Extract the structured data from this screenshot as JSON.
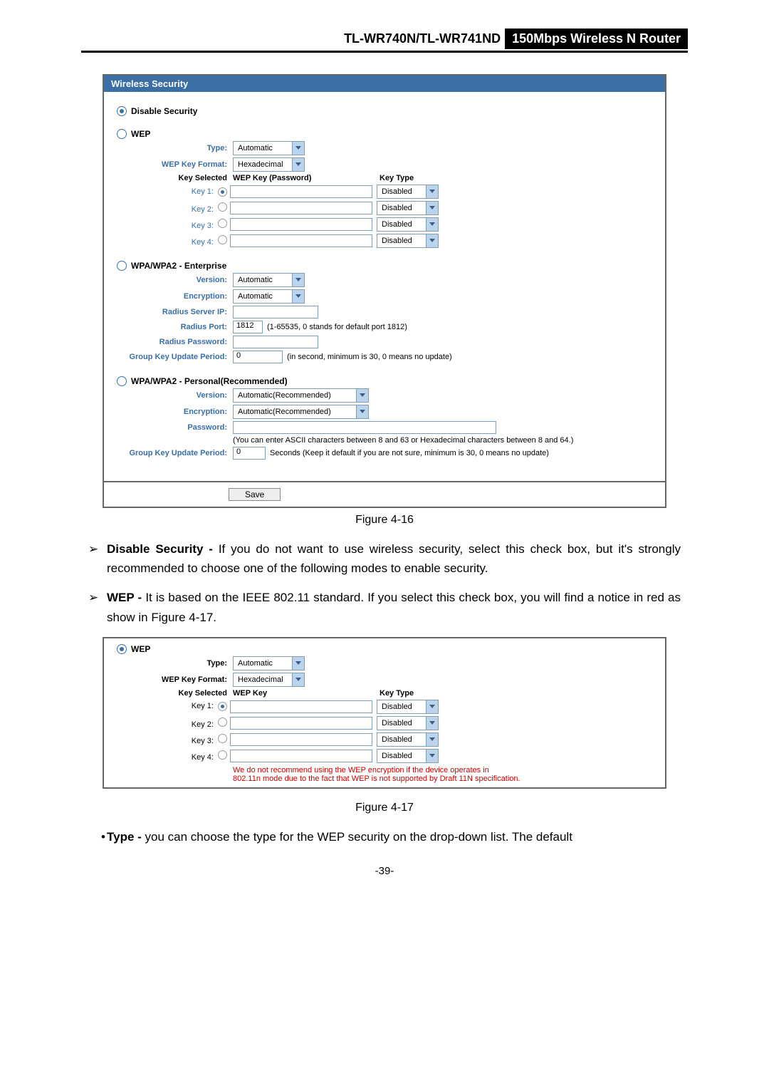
{
  "header": {
    "model": "TL-WR740N/TL-WR741ND",
    "desc": "150Mbps Wireless N Router"
  },
  "fig1": {
    "panel_title": "Wireless Security",
    "disable_label": "Disable Security",
    "wep": {
      "title": "WEP",
      "type_label": "Type:",
      "type_value": "Automatic",
      "keyformat_label": "WEP Key Format:",
      "keyformat_value": "Hexadecimal",
      "col_selected": "Key Selected",
      "col_key": "WEP Key (Password)",
      "col_type": "Key Type",
      "keys": [
        {
          "label": "Key 1:",
          "keytype": "Disabled",
          "selected": true
        },
        {
          "label": "Key 2:",
          "keytype": "Disabled",
          "selected": false
        },
        {
          "label": "Key 3:",
          "keytype": "Disabled",
          "selected": false
        },
        {
          "label": "Key 4:",
          "keytype": "Disabled",
          "selected": false
        }
      ]
    },
    "ent": {
      "title": "WPA/WPA2 - Enterprise",
      "version_label": "Version:",
      "version_value": "Automatic",
      "encryption_label": "Encryption:",
      "encryption_value": "Automatic",
      "radius_ip_label": "Radius Server IP:",
      "radius_port_label": "Radius Port:",
      "radius_port_value": "1812",
      "radius_port_hint": "(1-65535, 0 stands for default port 1812)",
      "radius_pwd_label": "Radius Password:",
      "gkup_label": "Group Key Update Period:",
      "gkup_value": "0",
      "gkup_hint": "(in second, minimum is 30, 0 means no update)"
    },
    "psk": {
      "title": "WPA/WPA2 - Personal(Recommended)",
      "version_label": "Version:",
      "version_value": "Automatic(Recommended)",
      "encryption_label": "Encryption:",
      "encryption_value": "Automatic(Recommended)",
      "password_label": "Password:",
      "password_hint": "(You can enter ASCII characters between 8 and 63 or Hexadecimal characters between 8 and 64.)",
      "gkup_label": "Group Key Update Period:",
      "gkup_value": "0",
      "gkup_hint": "Seconds (Keep it default if you are not sure, minimum is 30, 0 means no update)"
    },
    "save": "Save",
    "caption": "Figure 4-16"
  },
  "doc": {
    "li1_b": "Disable Security -",
    "li1": " If you do not want to use wireless security, select this check box, but it's strongly recommended to choose one of the following modes to enable security.",
    "li2_b": "WEP -",
    "li2": " It is based on the IEEE 802.11 standard. If you select this check box, you will find a notice in red as show in Figure 4-17."
  },
  "fig2": {
    "title": "WEP",
    "type_label": "Type:",
    "type_value": "Automatic",
    "keyformat_label": "WEP Key Format:",
    "keyformat_value": "Hexadecimal",
    "col_selected": "Key Selected",
    "col_key": "WEP Key",
    "col_type": "Key Type",
    "keys": [
      {
        "label": "Key 1:",
        "keytype": "Disabled",
        "selected": true
      },
      {
        "label": "Key 2:",
        "keytype": "Disabled",
        "selected": false
      },
      {
        "label": "Key 3:",
        "keytype": "Disabled",
        "selected": false
      },
      {
        "label": "Key 4:",
        "keytype": "Disabled",
        "selected": false
      }
    ],
    "warn1": "We do not recommend using the WEP encryption if the device operates in",
    "warn2": "802.11n mode due to the fact that WEP is not supported by Draft 11N specification.",
    "caption": "Figure 4-17"
  },
  "doc2": {
    "b": "Type -",
    "t": " you can choose the type for the WEP security on the drop-down list. The default"
  },
  "page_number": "-39-"
}
